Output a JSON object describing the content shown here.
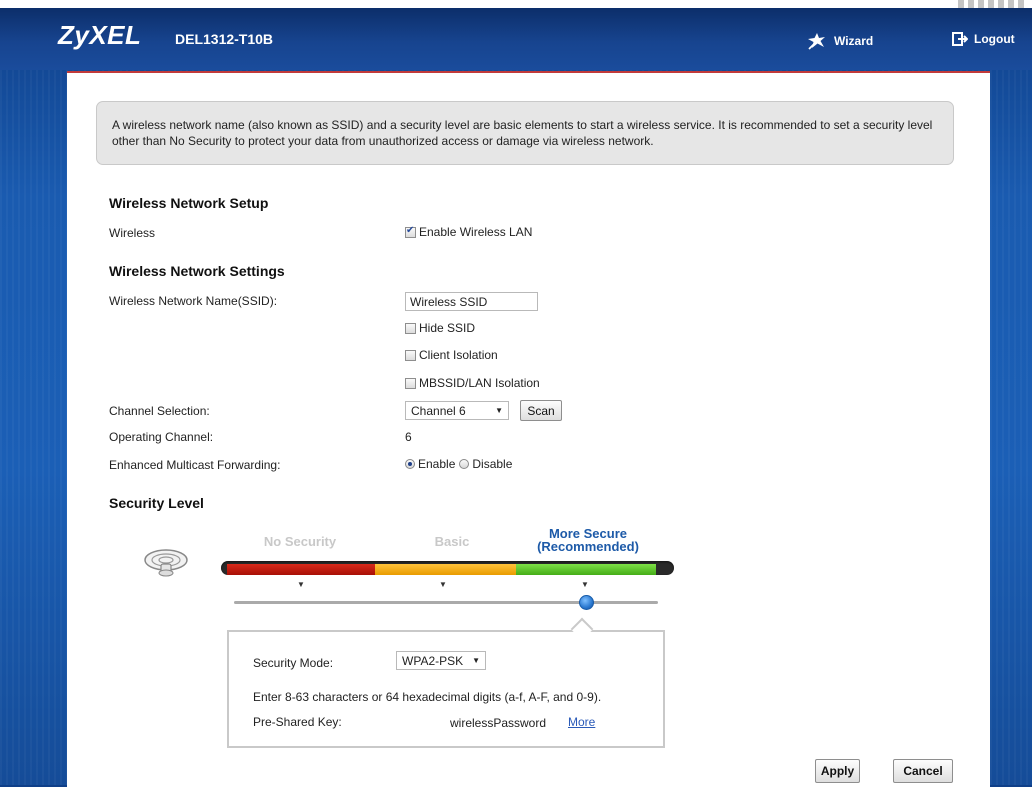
{
  "header": {
    "logo": "ZyXEL",
    "model": "DEL1312-T10B",
    "wizard_label": "Wizard",
    "logout_label": "Logout"
  },
  "info_text": "A wireless network name (also known as SSID) and a security level are basic elements to start a wireless service. It is recommended to set a security level other than No Security to protect your data from unauthorized access or damage via wireless network.",
  "setup": {
    "heading": "Wireless Network Setup",
    "wireless_label": "Wireless",
    "enable_wlan_label": "Enable Wireless LAN",
    "enable_wlan_checked": true
  },
  "settings": {
    "heading": "Wireless Network Settings",
    "ssid_label": "Wireless Network Name(SSID):",
    "ssid_value": "Wireless SSID",
    "hide_ssid_label": "Hide SSID",
    "client_isolation_label": "Client Isolation",
    "mbssid_label": "MBSSID/LAN Isolation",
    "channel_label": "Channel Selection:",
    "channel_value": "Channel 6",
    "scan_label": "Scan",
    "operating_channel_label": "Operating Channel:",
    "operating_channel_value": "6",
    "emf_label": "Enhanced Multicast Forwarding:",
    "emf_enable": "Enable",
    "emf_disable": "Disable",
    "emf_selected": "Enable"
  },
  "security": {
    "heading": "Security Level",
    "levels": [
      "No Security",
      "Basic",
      "More Secure",
      "(Recommended)"
    ],
    "active_level": "More Secure",
    "mode_label": "Security Mode:",
    "mode_value": "WPA2-PSK",
    "hint": "Enter 8-63 characters or 64 hexadecimal digits (a-f, A-F, and 0-9).",
    "psk_label": "Pre-Shared Key:",
    "psk_value": "wirelessPassword",
    "more_link": "More"
  },
  "actions": {
    "apply": "Apply",
    "cancel": "Cancel"
  },
  "colors": {
    "brand_blue": "#1a4c9c",
    "accent_red": "#c23a3a",
    "level_red": "#c0180c",
    "level_orange": "#f2a60f",
    "level_green": "#5cc02a",
    "active_text": "#1d5aa8"
  }
}
